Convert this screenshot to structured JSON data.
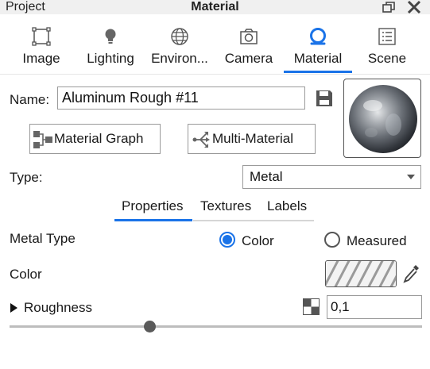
{
  "titlebar": {
    "left_label": "Project",
    "title": "Material"
  },
  "tabs": [
    {
      "label": "Image",
      "icon": "image-icon"
    },
    {
      "label": "Lighting",
      "icon": "lightbulb-icon"
    },
    {
      "label": "Environ...",
      "icon": "globe-icon"
    },
    {
      "label": "Camera",
      "icon": "camera-icon"
    },
    {
      "label": "Material",
      "icon": "material-sphere-icon",
      "active": true
    },
    {
      "label": "Scene",
      "icon": "list-icon"
    }
  ],
  "name": {
    "label": "Name:",
    "value": "Aluminum Rough #11"
  },
  "buttons": {
    "material_graph": "Material Graph",
    "multi_material": "Multi-Material"
  },
  "type": {
    "label": "Type:",
    "selected": "Metal"
  },
  "subtabs": {
    "properties": "Properties",
    "textures": "Textures",
    "labels": "Labels",
    "active": "Properties"
  },
  "metal_type": {
    "label": "Metal Type",
    "option_color": "Color",
    "option_measured": "Measured",
    "selected": "Color"
  },
  "color": {
    "label": "Color"
  },
  "roughness": {
    "label": "Roughness",
    "value": "0,1",
    "slider_fraction": 0.34
  },
  "colors": {
    "accent": "#1a73e8",
    "text": "#1a1a1a",
    "border": "#9a9a9a"
  }
}
